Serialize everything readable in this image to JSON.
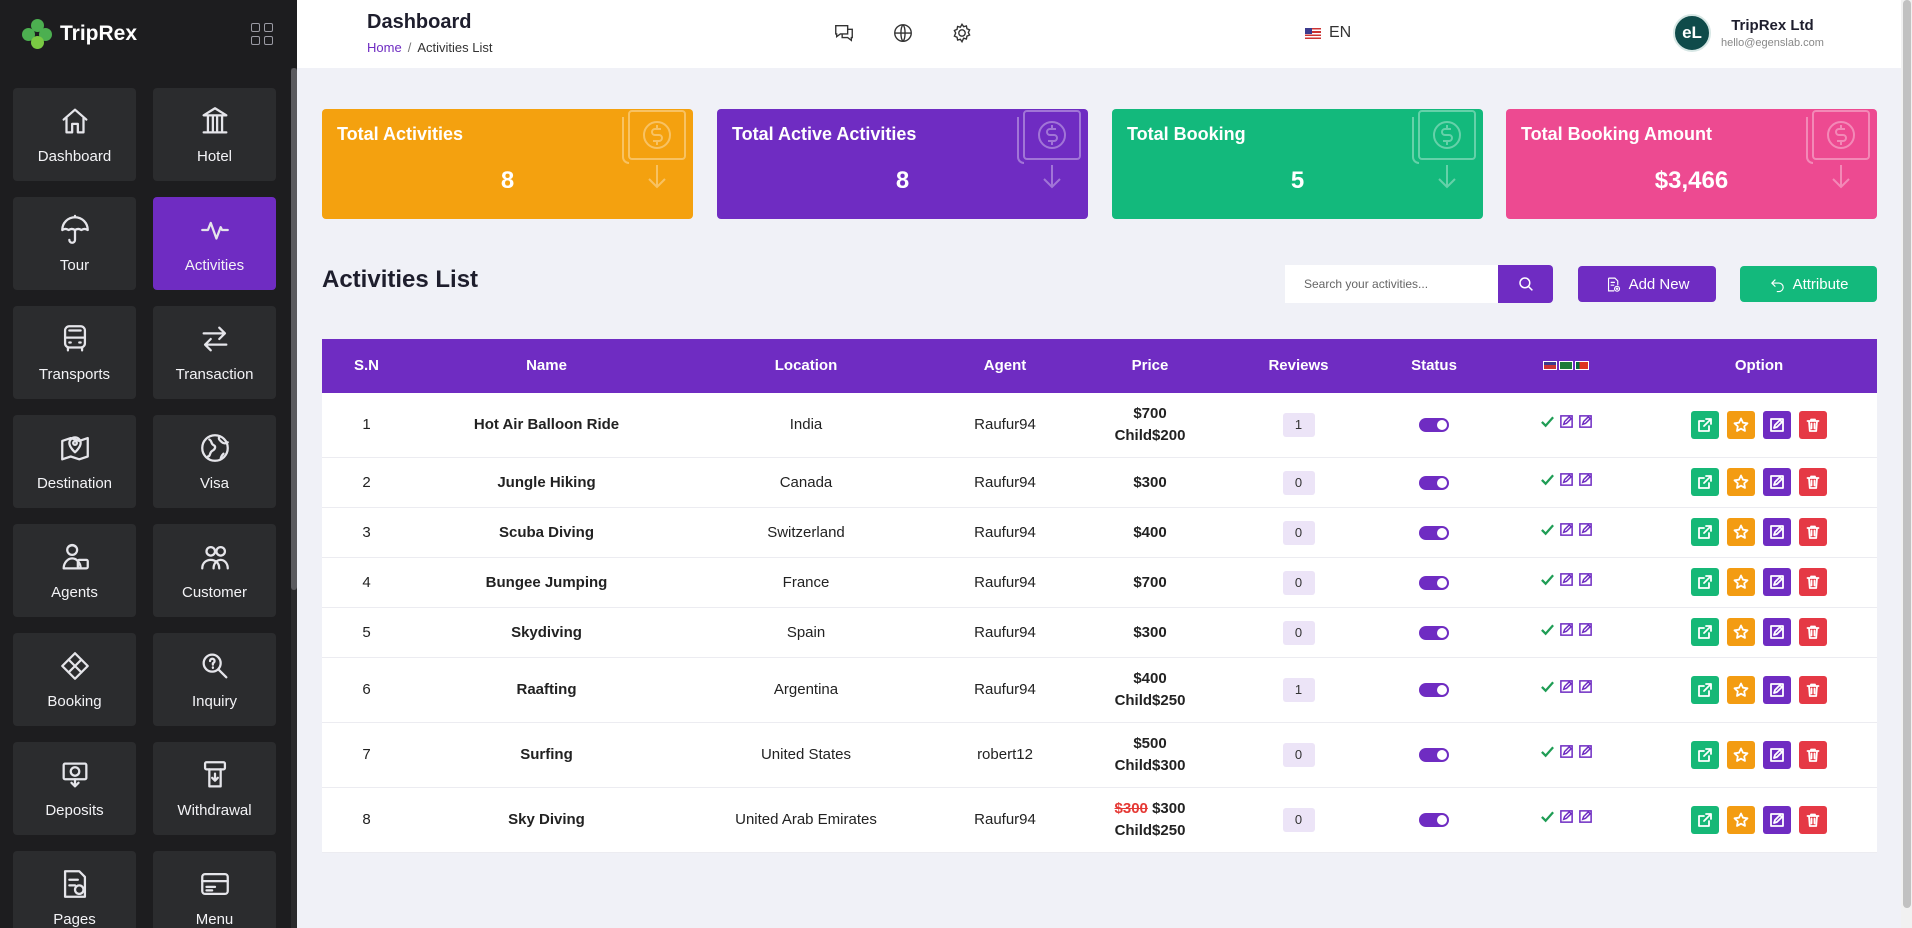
{
  "brand": {
    "name": "TripRex"
  },
  "sidebar": {
    "items": [
      {
        "label": "Dashboard",
        "icon": "home-icon",
        "active": false
      },
      {
        "label": "Hotel",
        "icon": "hotel-icon",
        "active": false
      },
      {
        "label": "Tour",
        "icon": "umbrella-icon",
        "active": false
      },
      {
        "label": "Activities",
        "icon": "activity-icon",
        "active": true
      },
      {
        "label": "Transports",
        "icon": "bus-icon",
        "active": false
      },
      {
        "label": "Transaction",
        "icon": "transfer-icon",
        "active": false
      },
      {
        "label": "Destination",
        "icon": "map-pin-icon",
        "active": false
      },
      {
        "label": "Visa",
        "icon": "globe-icon",
        "active": false
      },
      {
        "label": "Agents",
        "icon": "agent-icon",
        "active": false
      },
      {
        "label": "Customer",
        "icon": "customers-icon",
        "active": false
      },
      {
        "label": "Booking",
        "icon": "booking-icon",
        "active": false
      },
      {
        "label": "Inquiry",
        "icon": "inquiry-icon",
        "active": false
      },
      {
        "label": "Deposits",
        "icon": "deposit-icon",
        "active": false
      },
      {
        "label": "Withdrawal",
        "icon": "withdrawal-icon",
        "active": false
      },
      {
        "label": "Pages",
        "icon": "pages-icon",
        "active": false
      },
      {
        "label": "Menu",
        "icon": "menu-icon",
        "active": false
      }
    ]
  },
  "header": {
    "title": "Dashboard",
    "breadcrumb": {
      "home": "Home",
      "separator": "/",
      "current": "Activities List"
    },
    "language": "EN",
    "user": {
      "name": "TripRex Ltd",
      "email": "hello@egenslab.com",
      "initials": "eL"
    }
  },
  "stats": [
    {
      "title": "Total Activities",
      "value": "8",
      "color": "#f4a10f"
    },
    {
      "title": "Total Active Activities",
      "value": "8",
      "color": "#6f2cc2"
    },
    {
      "title": "Total Booking",
      "value": "5",
      "color": "#13b97c"
    },
    {
      "title": "Total Booking Amount",
      "value": "$3,466",
      "color": "#ed4a91"
    }
  ],
  "list": {
    "title": "Activities List",
    "search_placeholder": "Search your activities...",
    "add_label": "Add New",
    "attribute_label": "Attribute"
  },
  "table": {
    "headers": {
      "sn": "S.N",
      "name": "Name",
      "location": "Location",
      "agent": "Agent",
      "price": "Price",
      "reviews": "Reviews",
      "status": "Status",
      "option": "Option"
    },
    "rows": [
      {
        "sn": "1",
        "name": "Hot Air Balloon Ride",
        "location": "India",
        "agent": "Raufur94",
        "price_old": "",
        "price": "$700",
        "child": "Child$200",
        "reviews": "1",
        "status_on": true
      },
      {
        "sn": "2",
        "name": "Jungle Hiking",
        "location": "Canada",
        "agent": "Raufur94",
        "price_old": "",
        "price": "$300",
        "child": "",
        "reviews": "0",
        "status_on": true
      },
      {
        "sn": "3",
        "name": "Scuba Diving",
        "location": "Switzerland",
        "agent": "Raufur94",
        "price_old": "",
        "price": "$400",
        "child": "",
        "reviews": "0",
        "status_on": true
      },
      {
        "sn": "4",
        "name": "Bungee Jumping",
        "location": "France",
        "agent": "Raufur94",
        "price_old": "",
        "price": "$700",
        "child": "",
        "reviews": "0",
        "status_on": true
      },
      {
        "sn": "5",
        "name": "Skydiving",
        "location": "Spain",
        "agent": "Raufur94",
        "price_old": "",
        "price": "$300",
        "child": "",
        "reviews": "0",
        "status_on": true
      },
      {
        "sn": "6",
        "name": "Raafting",
        "location": "Argentina",
        "agent": "Raufur94",
        "price_old": "",
        "price": "$400",
        "child": "Child$250",
        "reviews": "1",
        "status_on": true
      },
      {
        "sn": "7",
        "name": "Surfing",
        "location": "United States",
        "agent": "robert12",
        "price_old": "",
        "price": "$500",
        "child": "Child$300",
        "reviews": "0",
        "status_on": true
      },
      {
        "sn": "8",
        "name": "Sky Diving",
        "location": "United Arab Emirates",
        "agent": "Raufur94",
        "price_old": "$300",
        "price": "$300",
        "child": "Child$250",
        "reviews": "0",
        "status_on": true
      }
    ]
  }
}
